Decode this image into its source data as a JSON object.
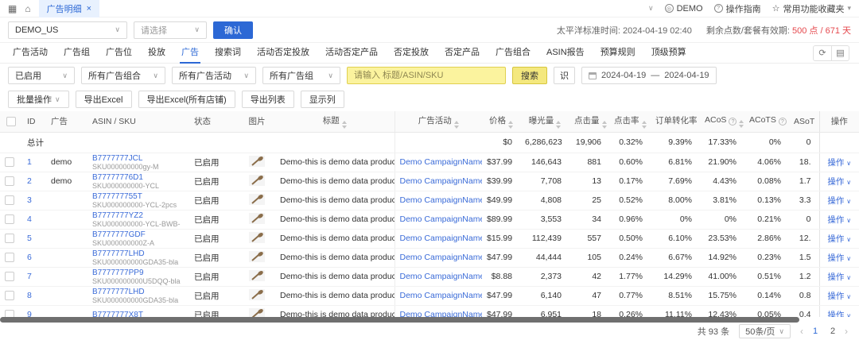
{
  "topbar": {
    "tab_label": "广告明细",
    "account_label": "DEMO",
    "guide_label": "操作指南",
    "favorites_label": "常用功能收藏夹"
  },
  "store_bar": {
    "store_value": "DEMO_US",
    "secondary_placeholder": "请选择",
    "confirm_label": "确认",
    "timezone_text": "太平洋标准时间: 2024-04-19 02:40",
    "quota_label": "剩余点数/套餐有效期: ",
    "quota_value": "500 点 / 671 天"
  },
  "nav": {
    "items": [
      "广告活动",
      "广告组",
      "广告位",
      "投放",
      "广告",
      "搜索词",
      "活动否定投放",
      "活动否定产品",
      "否定投放",
      "否定产品",
      "广告组合",
      "ASIN报告",
      "预算规则",
      "顶级预算"
    ],
    "active_index": 4
  },
  "filters": {
    "status_value": "已启用",
    "portfolio_value": "所有广告组合",
    "campaign_value": "所有广告活动",
    "adgroup_value": "所有广告组",
    "search_placeholder": "请输入 标题/ASIN/SKU",
    "search_button": "搜索",
    "ocr_button": "识",
    "date_start": "2024-04-19",
    "date_separator": "—",
    "date_end": "2024-04-19"
  },
  "toolbar": {
    "bulk_label": "批量操作",
    "export_excel": "导出Excel",
    "export_excel_all": "导出Excel(所有店铺)",
    "export_list": "导出列表",
    "show_columns": "显示列"
  },
  "table": {
    "action_label": "操作",
    "columns": [
      {
        "key": "checkbox",
        "label": ""
      },
      {
        "key": "id",
        "label": "ID"
      },
      {
        "key": "ad",
        "label": "广告"
      },
      {
        "key": "asin",
        "label": "ASIN / SKU"
      },
      {
        "key": "status",
        "label": "状态"
      },
      {
        "key": "image",
        "label": "图片"
      },
      {
        "key": "title",
        "label": "标题",
        "sort": true
      },
      {
        "key": "campaign",
        "label": "广告活动",
        "sort": true
      },
      {
        "key": "price",
        "label": "价格",
        "sort": true
      },
      {
        "key": "impressions",
        "label": "曝光量",
        "sort": true
      },
      {
        "key": "clicks",
        "label": "点击量",
        "sort": true
      },
      {
        "key": "ctr",
        "label": "点击率",
        "sort": true
      },
      {
        "key": "cvr",
        "label": "订单转化率",
        "sort": true,
        "help": true
      },
      {
        "key": "acos",
        "label": "ACoS",
        "sort": true,
        "help": true
      },
      {
        "key": "acots",
        "label": "ACoTS",
        "sort": true,
        "help": true
      },
      {
        "key": "asot",
        "label": "ASoT"
      },
      {
        "key": "action",
        "label": "操作"
      }
    ],
    "summary": {
      "label": "总计",
      "price": "$0",
      "impressions": "6,286,623",
      "clicks": "19,906",
      "ctr": "0.32%",
      "cvr": "9.39%",
      "acos": "17.33%",
      "acots": "0%",
      "asot": "0"
    },
    "rows": [
      {
        "id": "1",
        "ad": "demo",
        "asin": "B7777777JCL",
        "sku": "SKU000000000gy-M",
        "status": "已启用",
        "title": "Demo-this is demo data product title",
        "campaign": "Demo CampaignName",
        "price": "$37.99",
        "impressions": "146,643",
        "clicks": "881",
        "ctr": "0.60%",
        "cvr": "6.81%",
        "acos": "21.90%",
        "acots": "4.06%",
        "asot": "18."
      },
      {
        "id": "2",
        "ad": "demo",
        "asin": "B77777776D1",
        "sku": "SKU000000000-YCL",
        "status": "已启用",
        "title": "Demo-this is demo data product title",
        "campaign": "Demo CampaignName",
        "price": "$39.99",
        "impressions": "7,708",
        "clicks": "13",
        "ctr": "0.17%",
        "cvr": "7.69%",
        "acos": "4.43%",
        "acots": "0.08%",
        "asot": "1.7"
      },
      {
        "id": "3",
        "ad": "",
        "asin": "B777777755T",
        "sku": "SKU000000000-YCL-2pcs",
        "status": "已启用",
        "title": "Demo-this is demo data product title",
        "campaign": "Demo CampaignName",
        "price": "$49.99",
        "impressions": "4,808",
        "clicks": "25",
        "ctr": "0.52%",
        "cvr": "8.00%",
        "acos": "3.81%",
        "acots": "0.13%",
        "asot": "3.3"
      },
      {
        "id": "4",
        "ad": "",
        "asin": "B7777777YZ2",
        "sku": "SKU000000000-YCL-BWB-",
        "status": "已启用",
        "title": "Demo-this is demo data product title",
        "campaign": "Demo CampaignName",
        "price": "$89.99",
        "impressions": "3,553",
        "clicks": "34",
        "ctr": "0.96%",
        "cvr": "0%",
        "acos": "0%",
        "acots": "0.21%",
        "asot": "0"
      },
      {
        "id": "5",
        "ad": "",
        "asin": "B7777777GDF",
        "sku": "SKU000000000Z-A",
        "status": "已启用",
        "title": "Demo-this is demo data product title",
        "campaign": "Demo CampaignName",
        "price": "$15.99",
        "impressions": "112,439",
        "clicks": "557",
        "ctr": "0.50%",
        "cvr": "6.10%",
        "acos": "23.53%",
        "acots": "2.86%",
        "asot": "12."
      },
      {
        "id": "6",
        "ad": "",
        "asin": "B7777777LHD",
        "sku": "SKU000000000GDA35-bla",
        "status": "已启用",
        "title": "Demo-this is demo data product title",
        "campaign": "Demo CampaignName",
        "price": "$47.99",
        "impressions": "44,444",
        "clicks": "105",
        "ctr": "0.24%",
        "cvr": "6.67%",
        "acos": "14.92%",
        "acots": "0.23%",
        "asot": "1.5"
      },
      {
        "id": "7",
        "ad": "",
        "asin": "B7777777PP9",
        "sku": "SKU000000000U5DQQ-bla",
        "status": "已启用",
        "title": "Demo-this is demo data product title",
        "campaign": "Demo CampaignName",
        "price": "$8.88",
        "impressions": "2,373",
        "clicks": "42",
        "ctr": "1.77%",
        "cvr": "14.29%",
        "acos": "41.00%",
        "acots": "0.51%",
        "asot": "1.2"
      },
      {
        "id": "8",
        "ad": "",
        "asin": "B7777777LHD",
        "sku": "SKU000000000GDA35-bla",
        "status": "已启用",
        "title": "Demo-this is demo data product title",
        "campaign": "Demo CampaignName",
        "price": "$47.99",
        "impressions": "6,140",
        "clicks": "47",
        "ctr": "0.77%",
        "cvr": "8.51%",
        "acos": "15.75%",
        "acots": "0.14%",
        "asot": "0.8"
      },
      {
        "id": "9",
        "ad": "",
        "asin": "B7777777X8T",
        "sku": "",
        "status": "已启用",
        "title": "Demo-this is demo data product title",
        "campaign": "Demo CampaignName",
        "price": "$47.99",
        "impressions": "6,951",
        "clicks": "18",
        "ctr": "0.26%",
        "cvr": "11.11%",
        "acos": "12.43%",
        "acots": "0.05%",
        "asot": "0.4"
      }
    ]
  },
  "footer": {
    "total_text": "共 93 条",
    "page_size": "50条/页",
    "pages": [
      "1",
      "2"
    ],
    "current_page_index": 0
  }
}
